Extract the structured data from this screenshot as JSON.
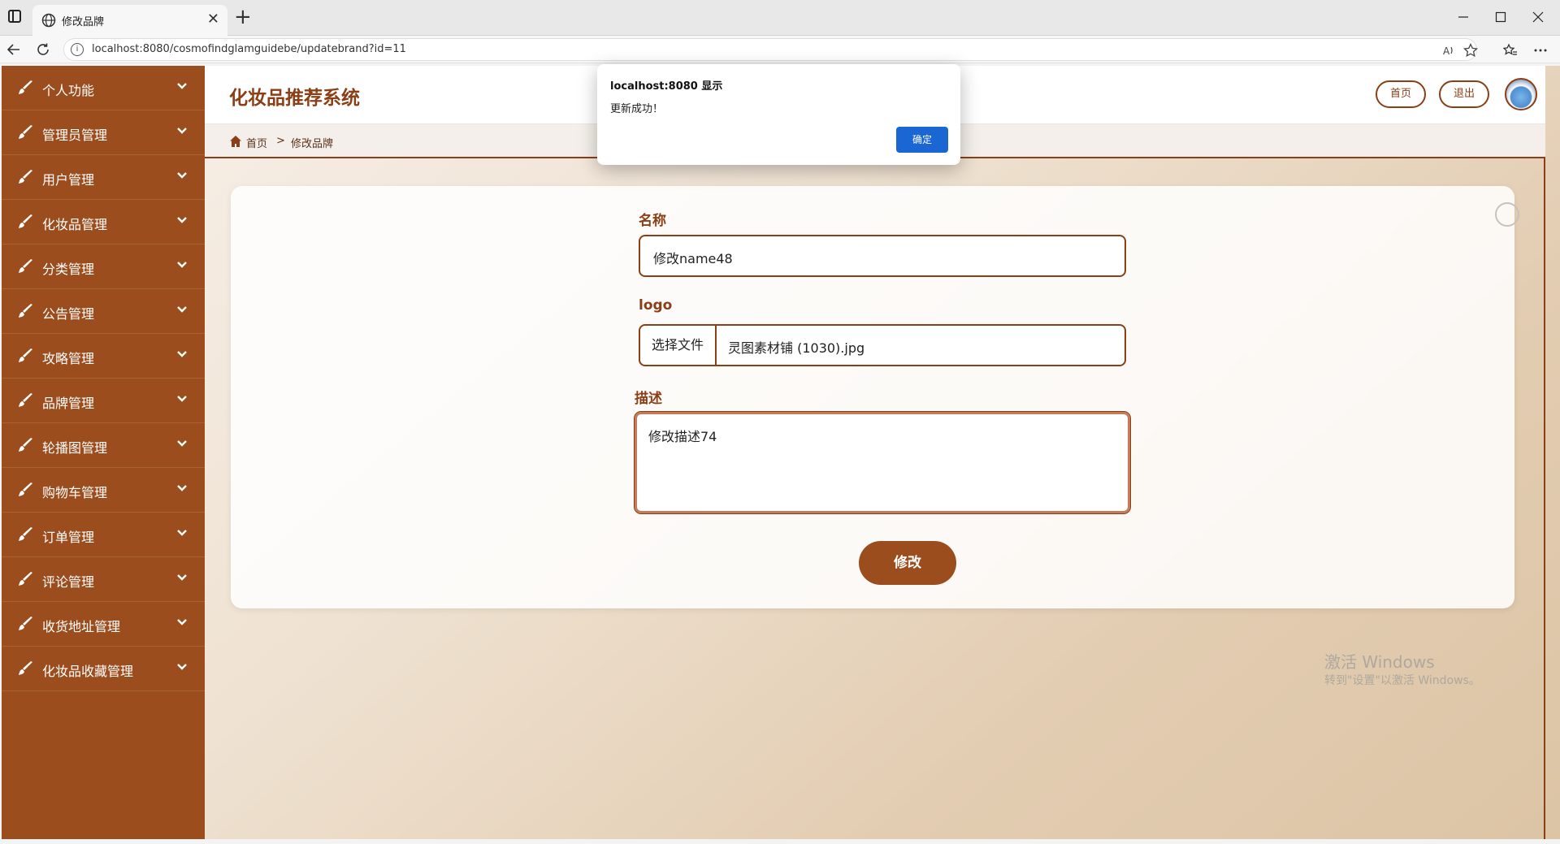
{
  "browser": {
    "tab_title": "修改品牌",
    "url": "localhost:8080/cosmofindglamguidebe/updatebrand?id=11",
    "new_tab_symbol": "+",
    "close_symbol": "✕"
  },
  "sidebar": {
    "items": [
      {
        "label": "个人功能"
      },
      {
        "label": "管理员管理"
      },
      {
        "label": "用户管理"
      },
      {
        "label": "化妆品管理"
      },
      {
        "label": "分类管理"
      },
      {
        "label": "公告管理"
      },
      {
        "label": "攻略管理"
      },
      {
        "label": "品牌管理"
      },
      {
        "label": "轮播图管理"
      },
      {
        "label": "购物车管理"
      },
      {
        "label": "订单管理"
      },
      {
        "label": "评论管理"
      },
      {
        "label": "收货地址管理"
      },
      {
        "label": "化妆品收藏管理"
      }
    ]
  },
  "header": {
    "title": "化妆品推荐系统",
    "home_button": "首页",
    "logout_button": "退出"
  },
  "breadcrumb": {
    "home": "首页",
    "separator": ">",
    "current": "修改品牌"
  },
  "form": {
    "name_label": "名称",
    "name_value": "修改name48",
    "logo_label": "logo",
    "file_button": "选择文件",
    "file_name": "灵图素材铺 (1030).jpg",
    "desc_label": "描述",
    "desc_value": "修改描述74",
    "submit_label": "修改"
  },
  "dialog": {
    "title": "localhost:8080 显示",
    "message": "更新成功！",
    "ok_label": "确定"
  },
  "watermark": {
    "line1": "激活 Windows",
    "line2": "转到\"设置\"以激活 Windows。"
  },
  "colors": {
    "sidebar": "#9c4d1d",
    "accent": "#8a3f16",
    "dialog_button": "#1a66d2"
  }
}
